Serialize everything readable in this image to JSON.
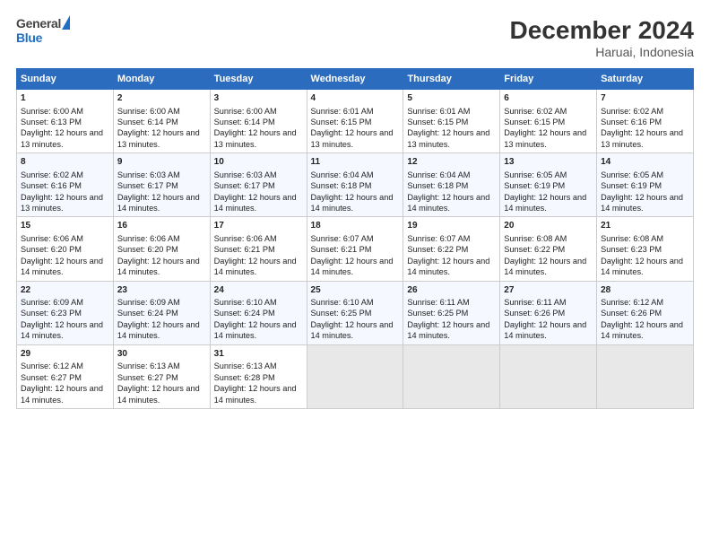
{
  "header": {
    "logo_general": "General",
    "logo_blue": "Blue",
    "title": "December 2024",
    "subtitle": "Haruai, Indonesia"
  },
  "days_of_week": [
    "Sunday",
    "Monday",
    "Tuesday",
    "Wednesday",
    "Thursday",
    "Friday",
    "Saturday"
  ],
  "weeks": [
    [
      {
        "day": "1",
        "sunrise": "6:00 AM",
        "sunset": "6:13 PM",
        "daylight": "12 hours and 13 minutes."
      },
      {
        "day": "2",
        "sunrise": "6:00 AM",
        "sunset": "6:14 PM",
        "daylight": "12 hours and 13 minutes."
      },
      {
        "day": "3",
        "sunrise": "6:00 AM",
        "sunset": "6:14 PM",
        "daylight": "12 hours and 13 minutes."
      },
      {
        "day": "4",
        "sunrise": "6:01 AM",
        "sunset": "6:15 PM",
        "daylight": "12 hours and 13 minutes."
      },
      {
        "day": "5",
        "sunrise": "6:01 AM",
        "sunset": "6:15 PM",
        "daylight": "12 hours and 13 minutes."
      },
      {
        "day": "6",
        "sunrise": "6:02 AM",
        "sunset": "6:15 PM",
        "daylight": "12 hours and 13 minutes."
      },
      {
        "day": "7",
        "sunrise": "6:02 AM",
        "sunset": "6:16 PM",
        "daylight": "12 hours and 13 minutes."
      }
    ],
    [
      {
        "day": "8",
        "sunrise": "6:02 AM",
        "sunset": "6:16 PM",
        "daylight": "12 hours and 13 minutes."
      },
      {
        "day": "9",
        "sunrise": "6:03 AM",
        "sunset": "6:17 PM",
        "daylight": "12 hours and 14 minutes."
      },
      {
        "day": "10",
        "sunrise": "6:03 AM",
        "sunset": "6:17 PM",
        "daylight": "12 hours and 14 minutes."
      },
      {
        "day": "11",
        "sunrise": "6:04 AM",
        "sunset": "6:18 PM",
        "daylight": "12 hours and 14 minutes."
      },
      {
        "day": "12",
        "sunrise": "6:04 AM",
        "sunset": "6:18 PM",
        "daylight": "12 hours and 14 minutes."
      },
      {
        "day": "13",
        "sunrise": "6:05 AM",
        "sunset": "6:19 PM",
        "daylight": "12 hours and 14 minutes."
      },
      {
        "day": "14",
        "sunrise": "6:05 AM",
        "sunset": "6:19 PM",
        "daylight": "12 hours and 14 minutes."
      }
    ],
    [
      {
        "day": "15",
        "sunrise": "6:06 AM",
        "sunset": "6:20 PM",
        "daylight": "12 hours and 14 minutes."
      },
      {
        "day": "16",
        "sunrise": "6:06 AM",
        "sunset": "6:20 PM",
        "daylight": "12 hours and 14 minutes."
      },
      {
        "day": "17",
        "sunrise": "6:06 AM",
        "sunset": "6:21 PM",
        "daylight": "12 hours and 14 minutes."
      },
      {
        "day": "18",
        "sunrise": "6:07 AM",
        "sunset": "6:21 PM",
        "daylight": "12 hours and 14 minutes."
      },
      {
        "day": "19",
        "sunrise": "6:07 AM",
        "sunset": "6:22 PM",
        "daylight": "12 hours and 14 minutes."
      },
      {
        "day": "20",
        "sunrise": "6:08 AM",
        "sunset": "6:22 PM",
        "daylight": "12 hours and 14 minutes."
      },
      {
        "day": "21",
        "sunrise": "6:08 AM",
        "sunset": "6:23 PM",
        "daylight": "12 hours and 14 minutes."
      }
    ],
    [
      {
        "day": "22",
        "sunrise": "6:09 AM",
        "sunset": "6:23 PM",
        "daylight": "12 hours and 14 minutes."
      },
      {
        "day": "23",
        "sunrise": "6:09 AM",
        "sunset": "6:24 PM",
        "daylight": "12 hours and 14 minutes."
      },
      {
        "day": "24",
        "sunrise": "6:10 AM",
        "sunset": "6:24 PM",
        "daylight": "12 hours and 14 minutes."
      },
      {
        "day": "25",
        "sunrise": "6:10 AM",
        "sunset": "6:25 PM",
        "daylight": "12 hours and 14 minutes."
      },
      {
        "day": "26",
        "sunrise": "6:11 AM",
        "sunset": "6:25 PM",
        "daylight": "12 hours and 14 minutes."
      },
      {
        "day": "27",
        "sunrise": "6:11 AM",
        "sunset": "6:26 PM",
        "daylight": "12 hours and 14 minutes."
      },
      {
        "day": "28",
        "sunrise": "6:12 AM",
        "sunset": "6:26 PM",
        "daylight": "12 hours and 14 minutes."
      }
    ],
    [
      {
        "day": "29",
        "sunrise": "6:12 AM",
        "sunset": "6:27 PM",
        "daylight": "12 hours and 14 minutes."
      },
      {
        "day": "30",
        "sunrise": "6:13 AM",
        "sunset": "6:27 PM",
        "daylight": "12 hours and 14 minutes."
      },
      {
        "day": "31",
        "sunrise": "6:13 AM",
        "sunset": "6:28 PM",
        "daylight": "12 hours and 14 minutes."
      },
      null,
      null,
      null,
      null
    ]
  ]
}
